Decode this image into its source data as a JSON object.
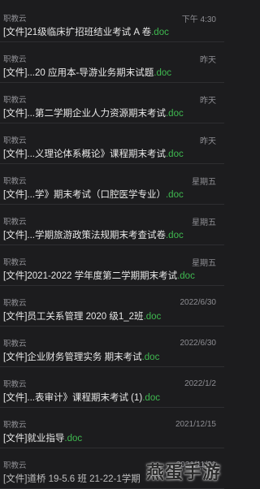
{
  "messages": [
    {
      "sender": "职教云",
      "time": "下午 4:30",
      "prefix": "[文件]21级临床扩招班结业考试 A 卷",
      "ext": ".doc"
    },
    {
      "sender": "职教云",
      "time": "昨天",
      "prefix": "[文件]...20 应用本-导游业务期末试题",
      "ext": ".doc"
    },
    {
      "sender": "职教云",
      "time": "昨天",
      "prefix": "[文件]...第二学期企业人力资源期末考试",
      "ext": ".doc"
    },
    {
      "sender": "职教云",
      "time": "昨天",
      "prefix": "[文件]...义理论体系概论》课程期末考试",
      "ext": ".doc"
    },
    {
      "sender": "职教云",
      "time": "星期五",
      "prefix": "[文件]...学》期末考试（口腔医学专业）",
      "ext": ".doc"
    },
    {
      "sender": "职教云",
      "time": "星期五",
      "prefix": "[文件]...学期旅游政策法规期末考查试卷",
      "ext": ".doc"
    },
    {
      "sender": "职教云",
      "time": "星期五",
      "prefix": "[文件]2021-2022 学年度第二学期期末考试",
      "ext": ".doc"
    },
    {
      "sender": "职教云",
      "time": "2022/6/30",
      "prefix": "[文件]员工关系管理 2020 级1_2班",
      "ext": ".doc"
    },
    {
      "sender": "职教云",
      "time": "2022/6/30",
      "prefix": "[文件]企业财务管理实务 期末考试",
      "ext": ".doc"
    },
    {
      "sender": "职教云",
      "time": "2022/1/2",
      "prefix": "[文件]...表审计》课程期末考试 (1)",
      "ext": ".doc"
    },
    {
      "sender": "职教云",
      "time": "2021/12/15",
      "prefix": "[文件]就业指导",
      "ext": ".doc"
    },
    {
      "sender": "职教云",
      "time": "2021/11/21",
      "prefix": "[文件]道桥 19-5.6 班 21-22-1学期",
      "ext": ""
    }
  ],
  "watermark": "燕蛋手游"
}
